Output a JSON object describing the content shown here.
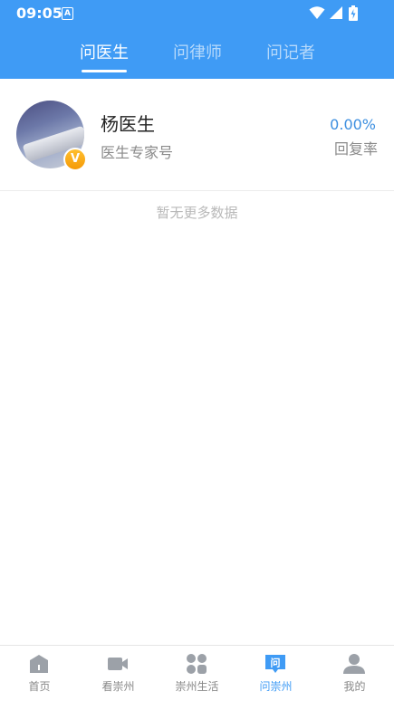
{
  "status_bar": {
    "time": "09:05",
    "notification_glyph": "A"
  },
  "tabs": [
    {
      "label": "问医生",
      "active": true
    },
    {
      "label": "问律师",
      "active": false
    },
    {
      "label": "问记者",
      "active": false
    }
  ],
  "doctor": {
    "name": "杨医生",
    "subtitle": "医生专家号",
    "badge": "V",
    "rate_value": "0.00%",
    "rate_label": "回复率"
  },
  "list_footer": "暂无更多数据",
  "bottom_nav": [
    {
      "label": "首页",
      "icon": "home-icon",
      "active": false
    },
    {
      "label": "看崇州",
      "icon": "video-camera-icon",
      "active": false
    },
    {
      "label": "崇州生活",
      "icon": "apps-grid-icon",
      "active": false
    },
    {
      "label": "问崇州",
      "icon": "ask-chat-icon",
      "active": true
    },
    {
      "label": "我的",
      "icon": "user-profile-icon",
      "active": false
    }
  ],
  "colors": {
    "header": "#3f9bf5",
    "accent": "#3d8fe0",
    "badge": "#f59a07"
  }
}
